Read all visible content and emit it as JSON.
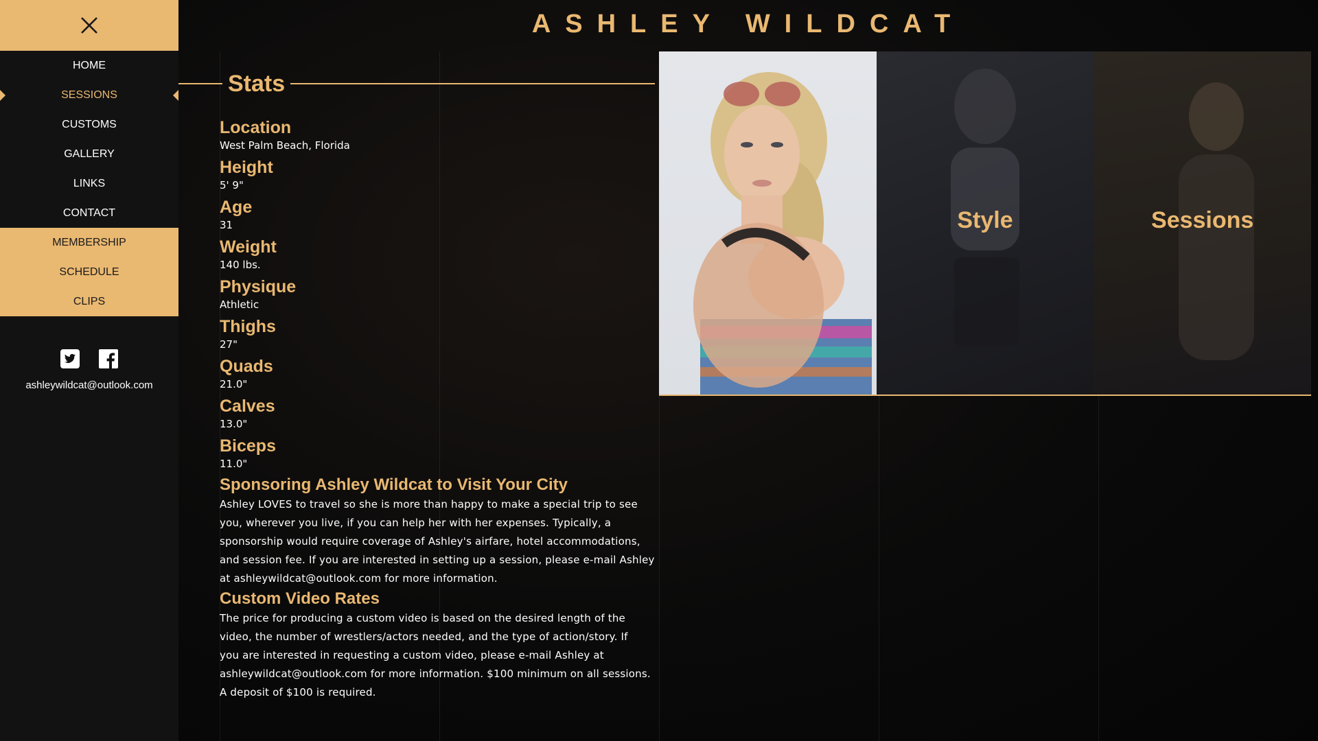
{
  "site": {
    "title": "ASHLEY WILDCAT"
  },
  "sidebar": {
    "close_icon": "close-x-icon",
    "nav_primary": [
      {
        "label": "HOME",
        "active": false
      },
      {
        "label": "SESSIONS",
        "active": true
      },
      {
        "label": "CUSTOMS",
        "active": false
      },
      {
        "label": "GALLERY",
        "active": false
      },
      {
        "label": "LINKS",
        "active": false
      },
      {
        "label": "CONTACT",
        "active": false
      }
    ],
    "nav_secondary": [
      {
        "label": "MEMBERSHIP"
      },
      {
        "label": "SCHEDULE"
      },
      {
        "label": "CLIPS"
      }
    ],
    "social_icons": [
      "twitter-icon",
      "facebook-icon"
    ],
    "email": "ashleywildcat@outlook.com"
  },
  "stats": {
    "heading": "Stats",
    "items": [
      {
        "label": "Location",
        "value": "West Palm Beach, Florida"
      },
      {
        "label": "Height",
        "value": "5' 9\""
      },
      {
        "label": "Age",
        "value": "31"
      },
      {
        "label": "Weight",
        "value": "140 lbs."
      },
      {
        "label": "Physique",
        "value": "Athletic"
      },
      {
        "label": "Thighs",
        "value": "27\""
      },
      {
        "label": "Quads",
        "value": "21.0\""
      },
      {
        "label": "Calves",
        "value": "13.0\""
      },
      {
        "label": "Biceps",
        "value": "11.0\""
      }
    ]
  },
  "sponsoring": {
    "heading": "Sponsoring Ashley Wildcat to Visit Your City",
    "lines": [
      "Ashley LOVES to travel so she is more than happy to make a special trip to see",
      "you, wherever you live, if you can help her with her expenses. Typically, a",
      "sponsorship would require coverage of Ashley's airfare, hotel accommodations,",
      "and session fee. If you are interested in setting up a session, please e-mail Ashley",
      "at ashleywildcat@outlook.com for more information."
    ]
  },
  "custom_video": {
    "heading": "Custom Video Rates",
    "lines": [
      "The price for producing a custom video is based on the desired length of the",
      "video, the number of wrestlers/actors needed, and the type of action/story. If",
      "you are interested in requesting a custom video, please e-mail Ashley at",
      "ashleywildcat@outlook.com for more information. $100 minimum on all sessions.",
      "A deposit of $100 is required."
    ]
  },
  "gallery": {
    "tiles": [
      {
        "label": ""
      },
      {
        "label": "Style"
      },
      {
        "label": "Sessions"
      }
    ]
  },
  "colors": {
    "accent": "#e9b871",
    "sidebar_bg": "#121212",
    "page_bg": "#050505"
  }
}
